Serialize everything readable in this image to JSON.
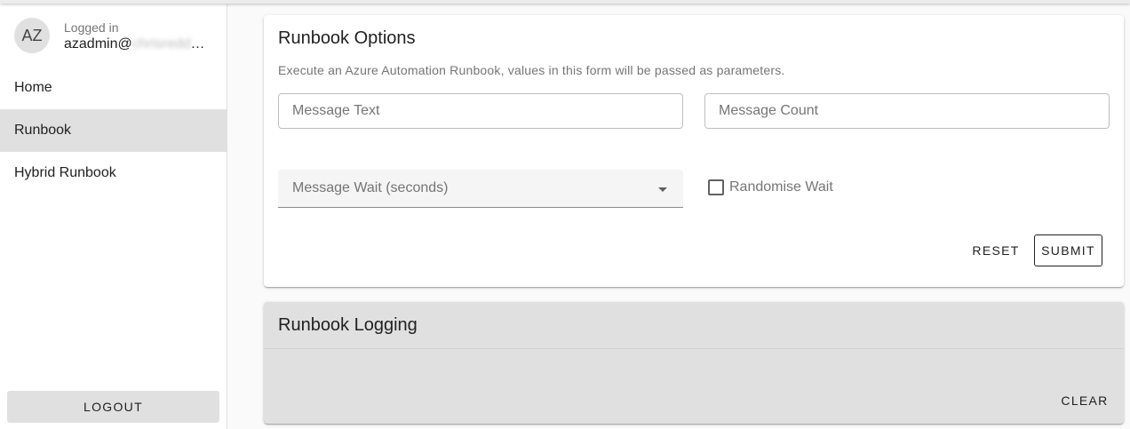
{
  "sidebar": {
    "avatar_initials": "AZ",
    "user_status": "Logged in",
    "user_name_visible": "azadmin@",
    "user_name_blurred": "chrisredd",
    "user_name_ellipsis": "…",
    "nav_items": [
      {
        "label": "Home",
        "active": false
      },
      {
        "label": "Runbook",
        "active": true
      },
      {
        "label": "Hybrid Runbook",
        "active": false
      }
    ],
    "logout_label": "LOGOUT"
  },
  "options_card": {
    "title": "Runbook Options",
    "description": "Execute an Azure Automation Runbook, values in this form will be passed as parameters.",
    "message_text_placeholder": "Message Text",
    "message_count_placeholder": "Message Count",
    "message_wait_label": "Message Wait (seconds)",
    "randomise_label": "Randomise Wait",
    "randomise_checked": false,
    "reset_label": "RESET",
    "submit_label": "SUBMIT"
  },
  "logging_card": {
    "title": "Runbook Logging",
    "clear_label": "CLEAR"
  }
}
